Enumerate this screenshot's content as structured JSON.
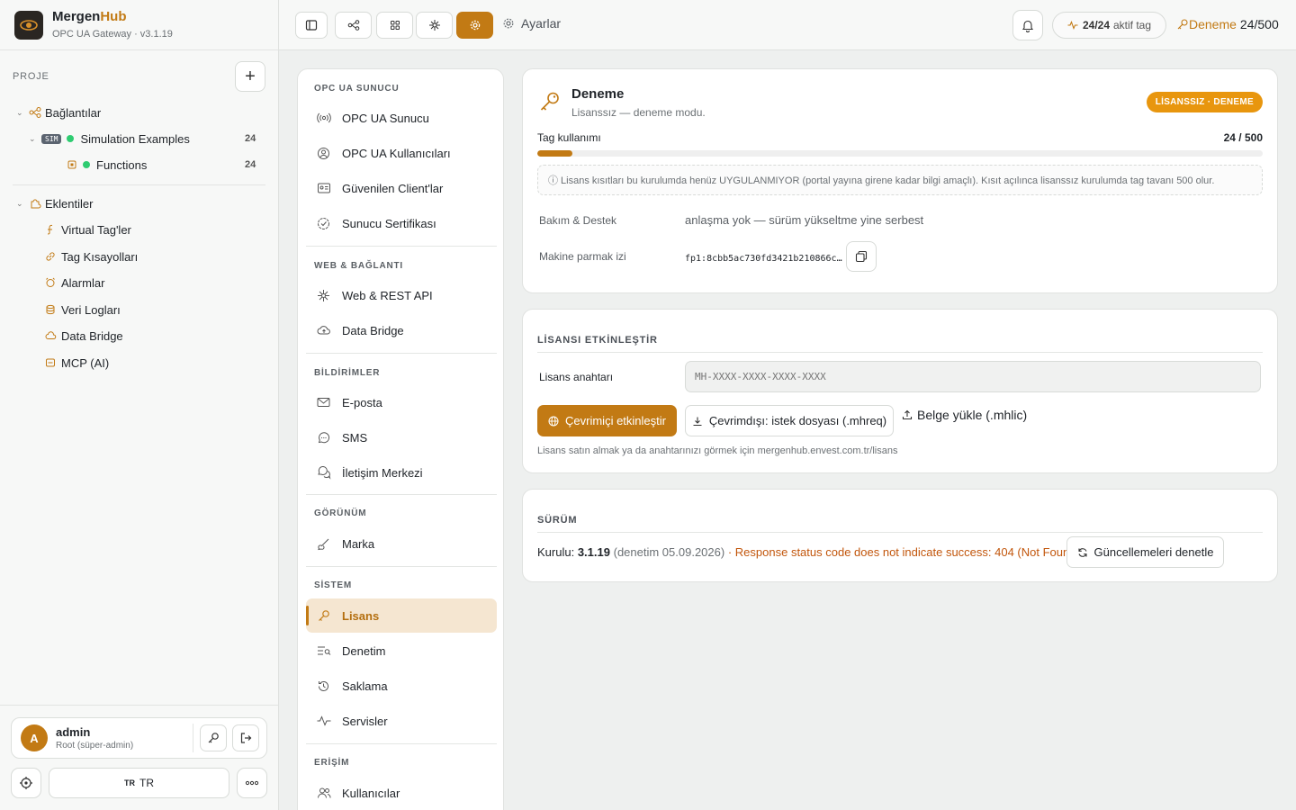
{
  "app": {
    "name_part1": "Mergen",
    "name_part2": "Hub",
    "subtitle": "OPC UA Gateway · v3.1.19"
  },
  "project": {
    "label": "PROJE",
    "connections_label": "Bağlantılar",
    "sim_badge": "SIM",
    "simulation": {
      "label": "Simulation Examples",
      "count": "24"
    },
    "functions": {
      "label": "Functions",
      "count": "24"
    },
    "plugins_label": "Eklentiler",
    "plugins": [
      "Virtual Tag'ler",
      "Tag Kısayolları",
      "Alarmlar",
      "Veri Logları",
      "Data Bridge",
      "MCP (AI)"
    ]
  },
  "user": {
    "initial": "A",
    "name": "admin",
    "role": "Root (süper-admin)"
  },
  "lang": {
    "code": "TR",
    "label": "TR"
  },
  "topbar": {
    "crumb": "Ayarlar",
    "tags_value": "24/24",
    "tags_label": "aktif tag",
    "trial_label": "Deneme",
    "trial_value": "24/500"
  },
  "menu": {
    "sections": [
      {
        "title": "OPC UA SUNUCU",
        "items": [
          "OPC UA Sunucu",
          "OPC UA Kullanıcıları",
          "Güvenilen Client'lar",
          "Sunucu Sertifikası"
        ]
      },
      {
        "title": "WEB & BAĞLANTI",
        "items": [
          "Web & REST API",
          "Data Bridge"
        ]
      },
      {
        "title": "BİLDİRİMLER",
        "items": [
          "E-posta",
          "SMS",
          "İletişim Merkezi"
        ]
      },
      {
        "title": "GÖRÜNÜM",
        "items": [
          "Marka"
        ]
      },
      {
        "title": "SİSTEM",
        "items": [
          "Lisans",
          "Denetim",
          "Saklama",
          "Servisler"
        ]
      },
      {
        "title": "ERİŞİM",
        "items": [
          "Kullanıcılar"
        ]
      }
    ]
  },
  "license": {
    "title": "Deneme",
    "subtitle": "Lisanssız — deneme modu.",
    "badge": "LİSANSSIZ · DENEME",
    "usage_label": "Tag kullanımı",
    "usage_value": "24 / 500",
    "usage_fraction": 0.048,
    "note": "ⓘ Lisans kısıtları bu kurulumda henüz UYGULANMIYOR (portal yayına girene kadar bilgi amaçlı). Kısıt açılınca lisanssız kurulumda tag tavanı 500 olur.",
    "support_label": "Bakım & Destek",
    "support_value": "anlaşma yok — sürüm yükseltme yine serbest",
    "fingerprint_label": "Makine parmak izi",
    "fingerprint_value": "fp1:8cbb5ac730fd3421b210866c…"
  },
  "activate": {
    "title": "LİSANSI ETKİNLEŞTİR",
    "key_label": "Lisans anahtarı",
    "key_placeholder": "MH-XXXX-XXXX-XXXX-XXXX",
    "online_btn": "Çevrimiçi etkinleştir",
    "offline_btn": "Çevrimdışı: istek dosyası (.mhreq)",
    "upload_btn": "Belge yükle (.mhlic)",
    "hint": "Lisans satın almak ya da anahtarınızı görmek için mergenhub.envest.com.tr/lisans"
  },
  "version": {
    "title": "SÜRÜM",
    "installed_label": "Kurulu:",
    "installed_value": "3.1.19",
    "audit": "(denetim 05.09.2026)",
    "sep": "·",
    "error": "Response status code does not indicate success: 404 (Not Found).",
    "check_btn": "Güncellemeleri denetle"
  },
  "colors": {
    "accent": "#c27a14",
    "badge": "#e8960e",
    "success": "#2ecc71",
    "error": "#c2560c"
  }
}
